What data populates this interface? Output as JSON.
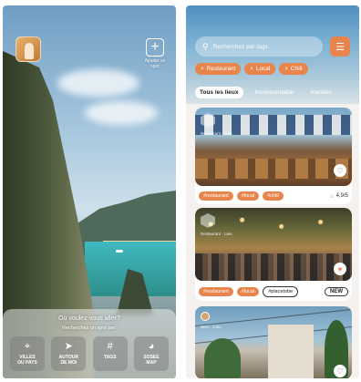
{
  "left_screen": {
    "add_spot_label": "Ajouter un spot",
    "sheet_title": "Où voulez-vous aller?",
    "sheet_subtitle": "Recherchez un spot par:",
    "quick_actions": [
      {
        "icon": "location-pin-icon",
        "glyph": "⌖",
        "label_line1": "VILLES",
        "label_line2": "OU PAYS"
      },
      {
        "icon": "navigation-arrow-icon",
        "glyph": "➤",
        "label_line1": "AUTOUR",
        "label_line2": "DE MOI"
      },
      {
        "icon": "hashtag-icon",
        "glyph": "#",
        "label_line1": "TAGS",
        "label_line2": ""
      },
      {
        "icon": "globe-icon",
        "glyph": "◕",
        "label_line1": "SOSEE",
        "label_line2": "MAP"
      }
    ]
  },
  "right_screen": {
    "search_placeholder": "Recherchez par tags",
    "filter_tags": [
      "Restaurant",
      "Local",
      "Chill"
    ],
    "tabs": [
      "Tous les lieux",
      "Incontournable",
      "Insolites"
    ],
    "active_tab": "Tous les lieux",
    "cards": [
      {
        "caption": "Restaurant · Lieu",
        "tags": [
          "#restaurant",
          "#local",
          "#chill"
        ],
        "rating": "4,9/5",
        "liked": false
      },
      {
        "caption": "Restaurant · Lieu",
        "tags": [
          "#restaurant",
          "#local",
          "#placetobe"
        ],
        "badge": "NEW",
        "liked": true
      },
      {
        "caption": "Sect. · Lieu",
        "liked": false
      }
    ]
  },
  "colors": {
    "accent": "#e8854d",
    "sheet_bg": "rgba(235,235,235,0.55)",
    "header_sky": "#7fb2d4"
  }
}
